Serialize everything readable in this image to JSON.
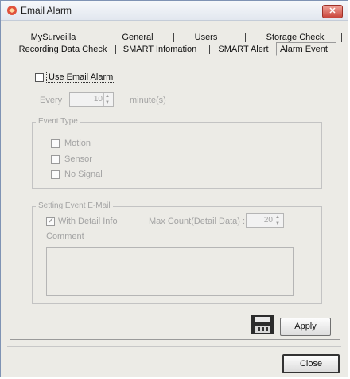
{
  "window": {
    "title": "Email Alarm",
    "close_symbol": "✕"
  },
  "tabs": {
    "row1": [
      "MySurveilla",
      "General",
      "Users",
      "Storage Check"
    ],
    "row2": [
      "Recording Data Check",
      "SMART Infomation",
      "SMART Alert",
      "Alarm Event"
    ],
    "active": "Alarm Event"
  },
  "alarm": {
    "use_email_label": "Use Email Alarm",
    "use_email_checked": false,
    "every_label": "Every",
    "every_value": "10",
    "every_unit": "minute(s)"
  },
  "event_type": {
    "legend": "Event Type",
    "items": [
      {
        "label": "Motion",
        "checked": false
      },
      {
        "label": "Sensor",
        "checked": false
      },
      {
        "label": "No Signal",
        "checked": false
      }
    ]
  },
  "setting": {
    "legend": "Setting Event E-Mail",
    "with_detail_label": "With Detail Info",
    "with_detail_checked": true,
    "max_count_label": "Max Count(Detail Data) :",
    "max_count_value": "20",
    "comment_label": "Comment",
    "comment_value": ""
  },
  "buttons": {
    "apply": "Apply",
    "close": "Close"
  },
  "colors": {
    "close_button": "#c8443a",
    "disabled_text": "#a3a3a3"
  }
}
